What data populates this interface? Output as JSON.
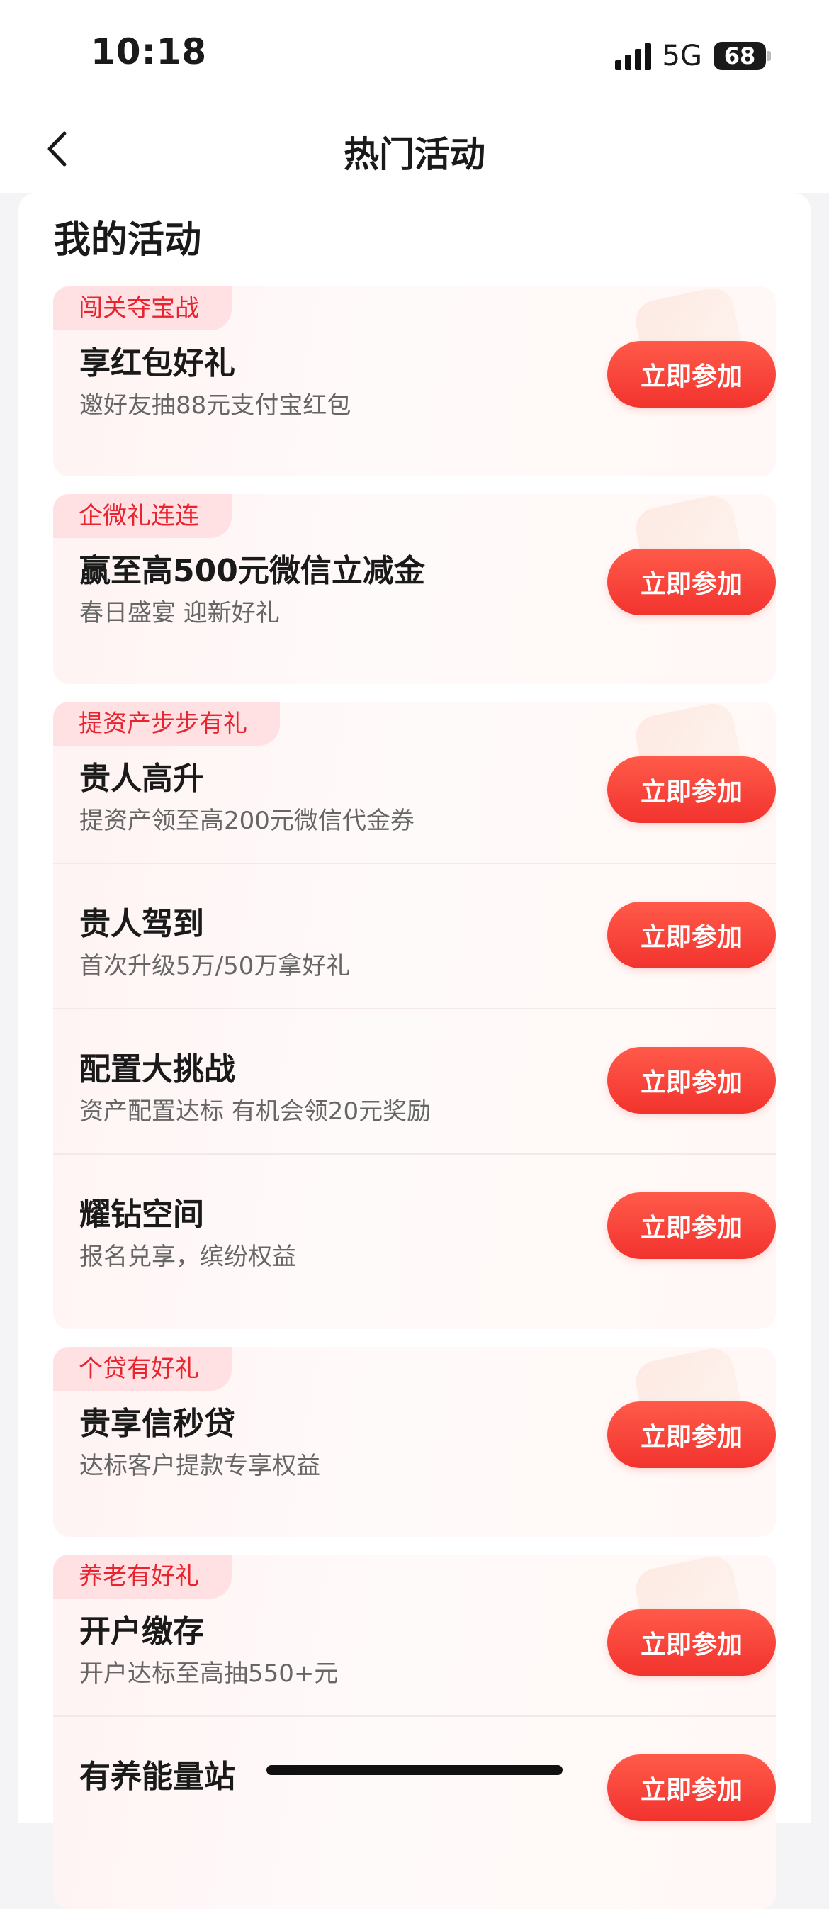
{
  "status_bar": {
    "time": "10:18",
    "network": "5G",
    "battery": "68"
  },
  "nav": {
    "title": "热门活动"
  },
  "section": {
    "title": "我的活动"
  },
  "button_label": "立即参加",
  "cards": [
    {
      "tag": "闯关夺宝战",
      "rows": [
        {
          "title": "享红包好礼",
          "subtitle": "邀好友抽88元支付宝红包"
        }
      ]
    },
    {
      "tag": "企微礼连连",
      "rows": [
        {
          "title": "赢至高500元微信立减金",
          "subtitle": "春日盛宴 迎新好礼"
        }
      ]
    },
    {
      "tag": "提资产步步有礼",
      "rows": [
        {
          "title": "贵人高升",
          "subtitle": "提资产领至高200元微信代金券"
        },
        {
          "title": "贵人驾到",
          "subtitle": "首次升级5万/50万拿好礼"
        },
        {
          "title": "配置大挑战",
          "subtitle": "资产配置达标 有机会领20元奖励"
        },
        {
          "title": "耀钻空间",
          "subtitle": "报名兑享，缤纷权益"
        }
      ]
    },
    {
      "tag": "个贷有好礼",
      "rows": [
        {
          "title": "贵享信秒贷",
          "subtitle": "达标客户提款专享权益"
        }
      ]
    },
    {
      "tag": "养老有好礼",
      "rows": [
        {
          "title": "开户缴存",
          "subtitle": "开户达标至高抽550+元"
        },
        {
          "title": "有养能量站",
          "subtitle": ""
        }
      ]
    }
  ]
}
